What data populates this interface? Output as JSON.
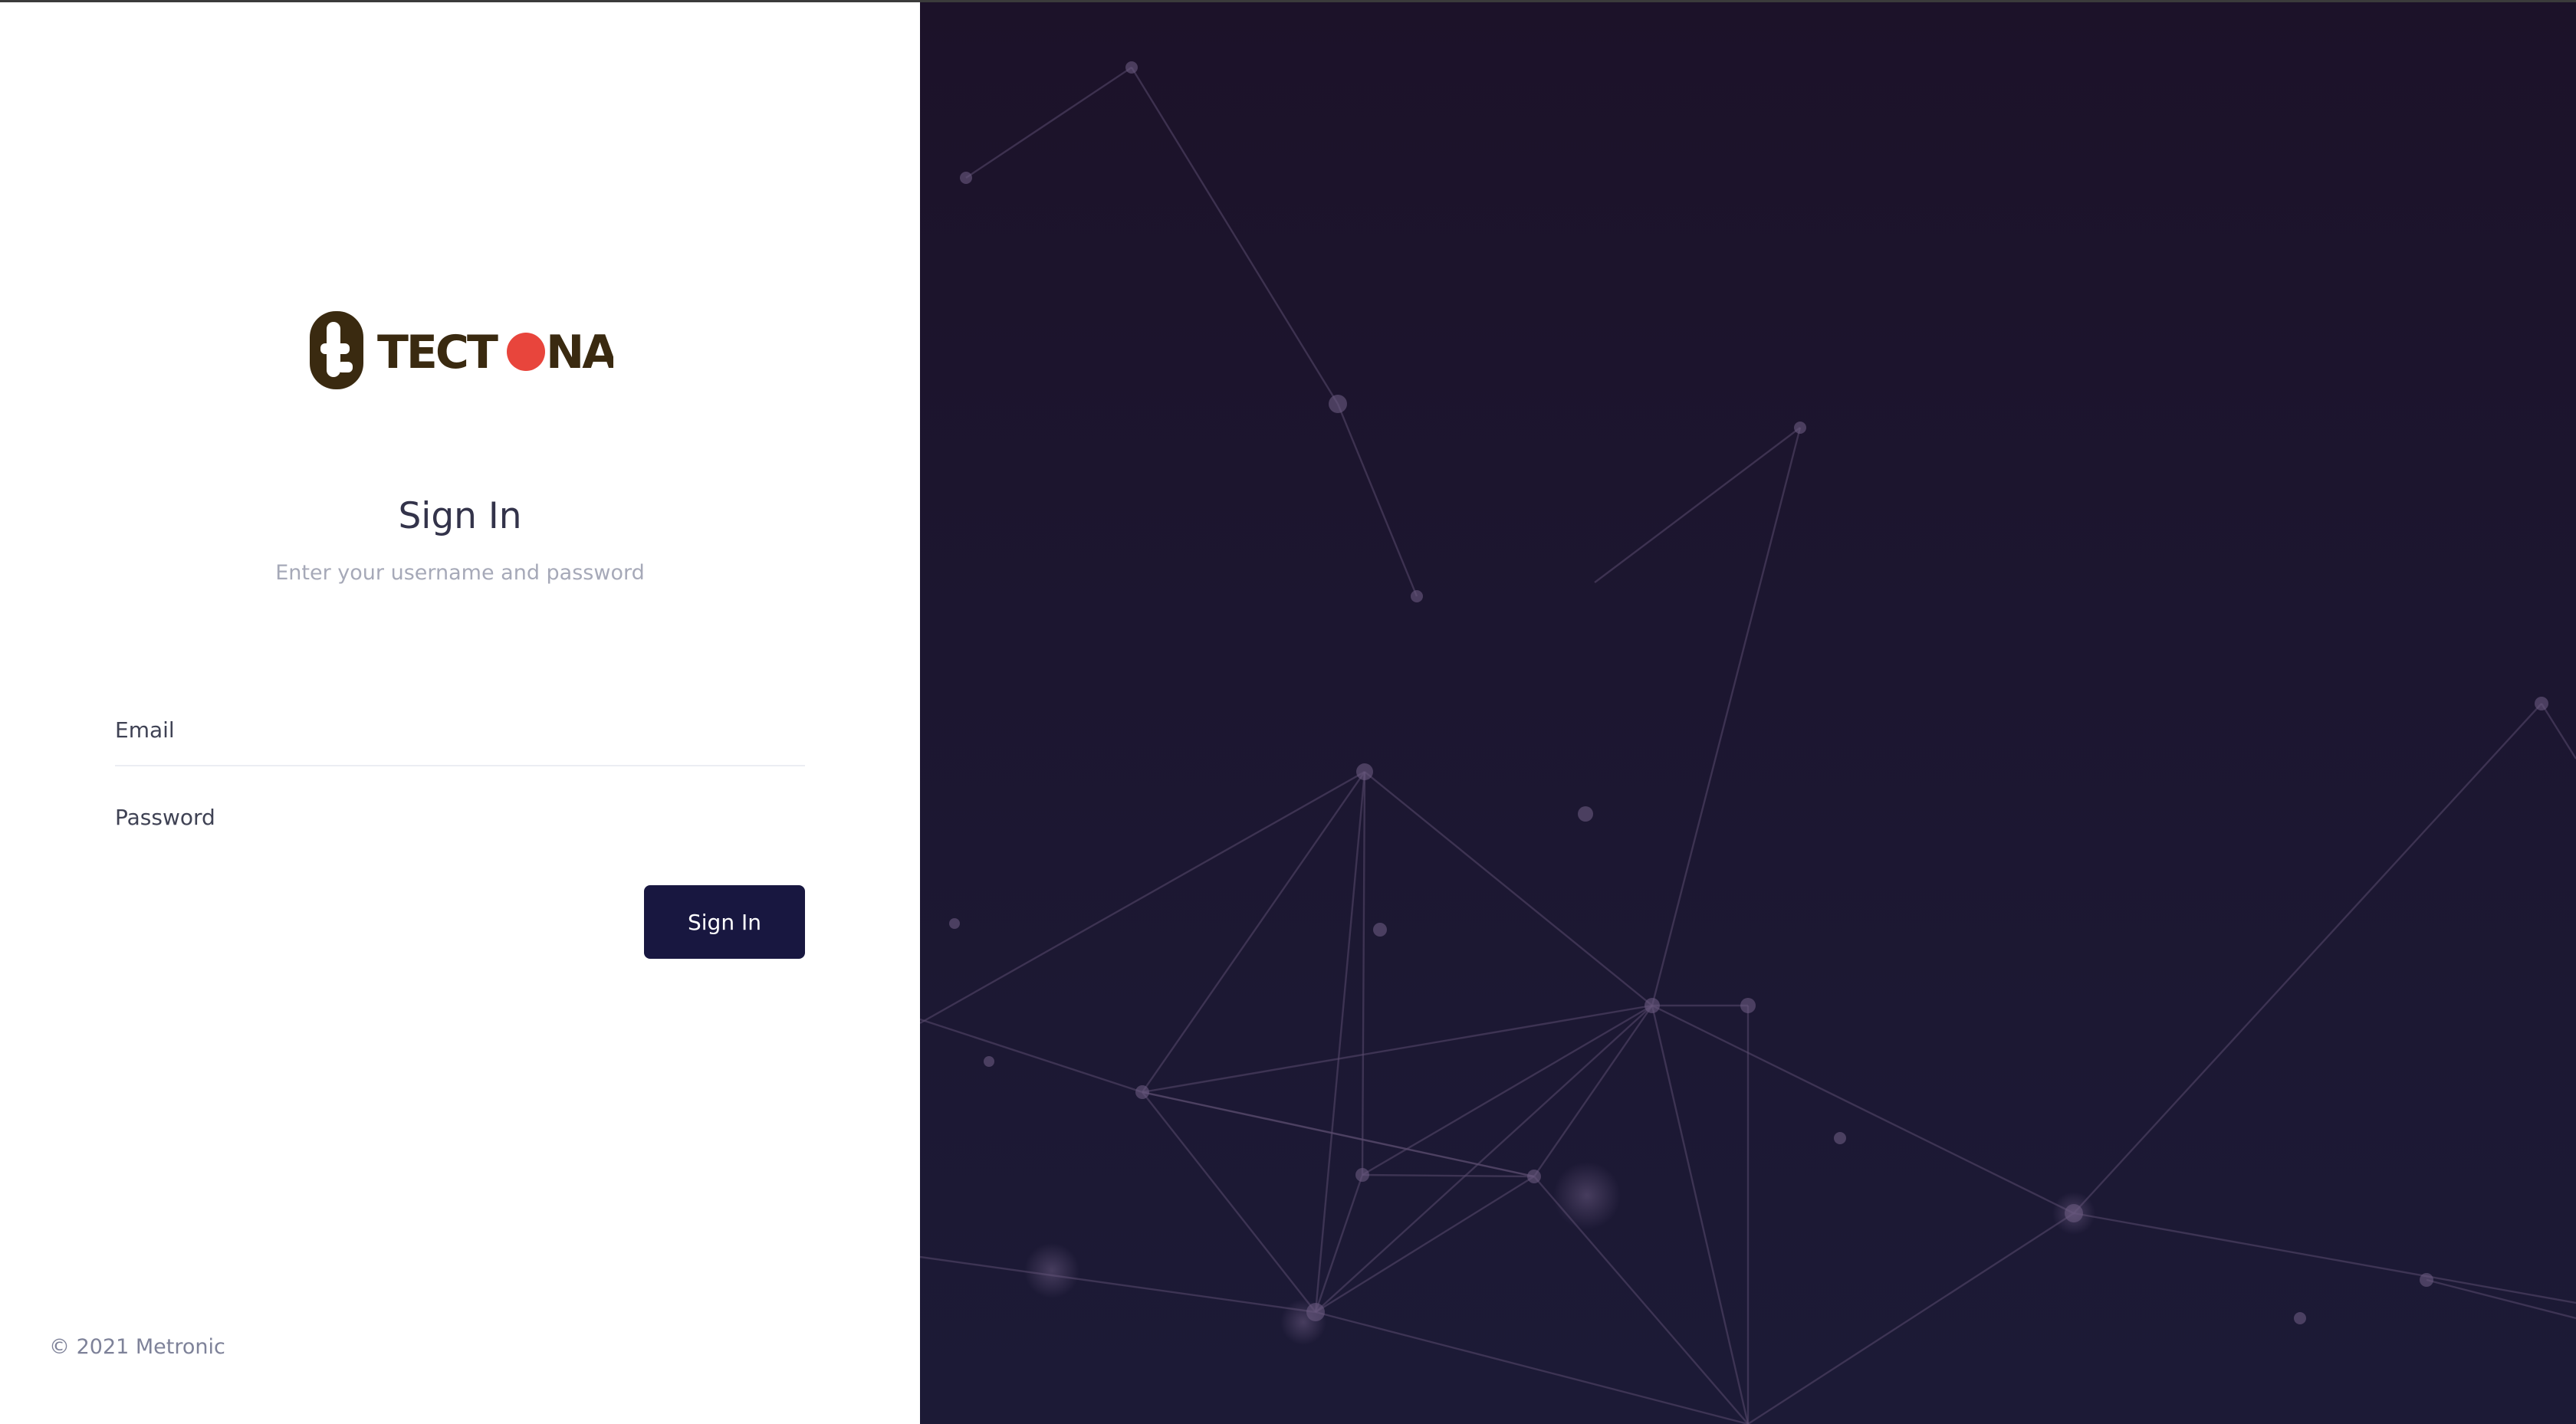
{
  "brand": {
    "logo_text": "TECTONA",
    "logo_text_color": "#3a2a10",
    "logo_dot_color": "#e8453c"
  },
  "signin": {
    "title": "Sign In",
    "subtitle": "Enter your username and password",
    "email_placeholder": "Email",
    "password_placeholder": "Password",
    "button_label": "Sign In"
  },
  "footer": {
    "copyright": "© 2021 Metronic"
  },
  "colors": {
    "button_bg": "#181740",
    "panel_bg": "#1c1630",
    "network_line": "#5a4a6e"
  }
}
